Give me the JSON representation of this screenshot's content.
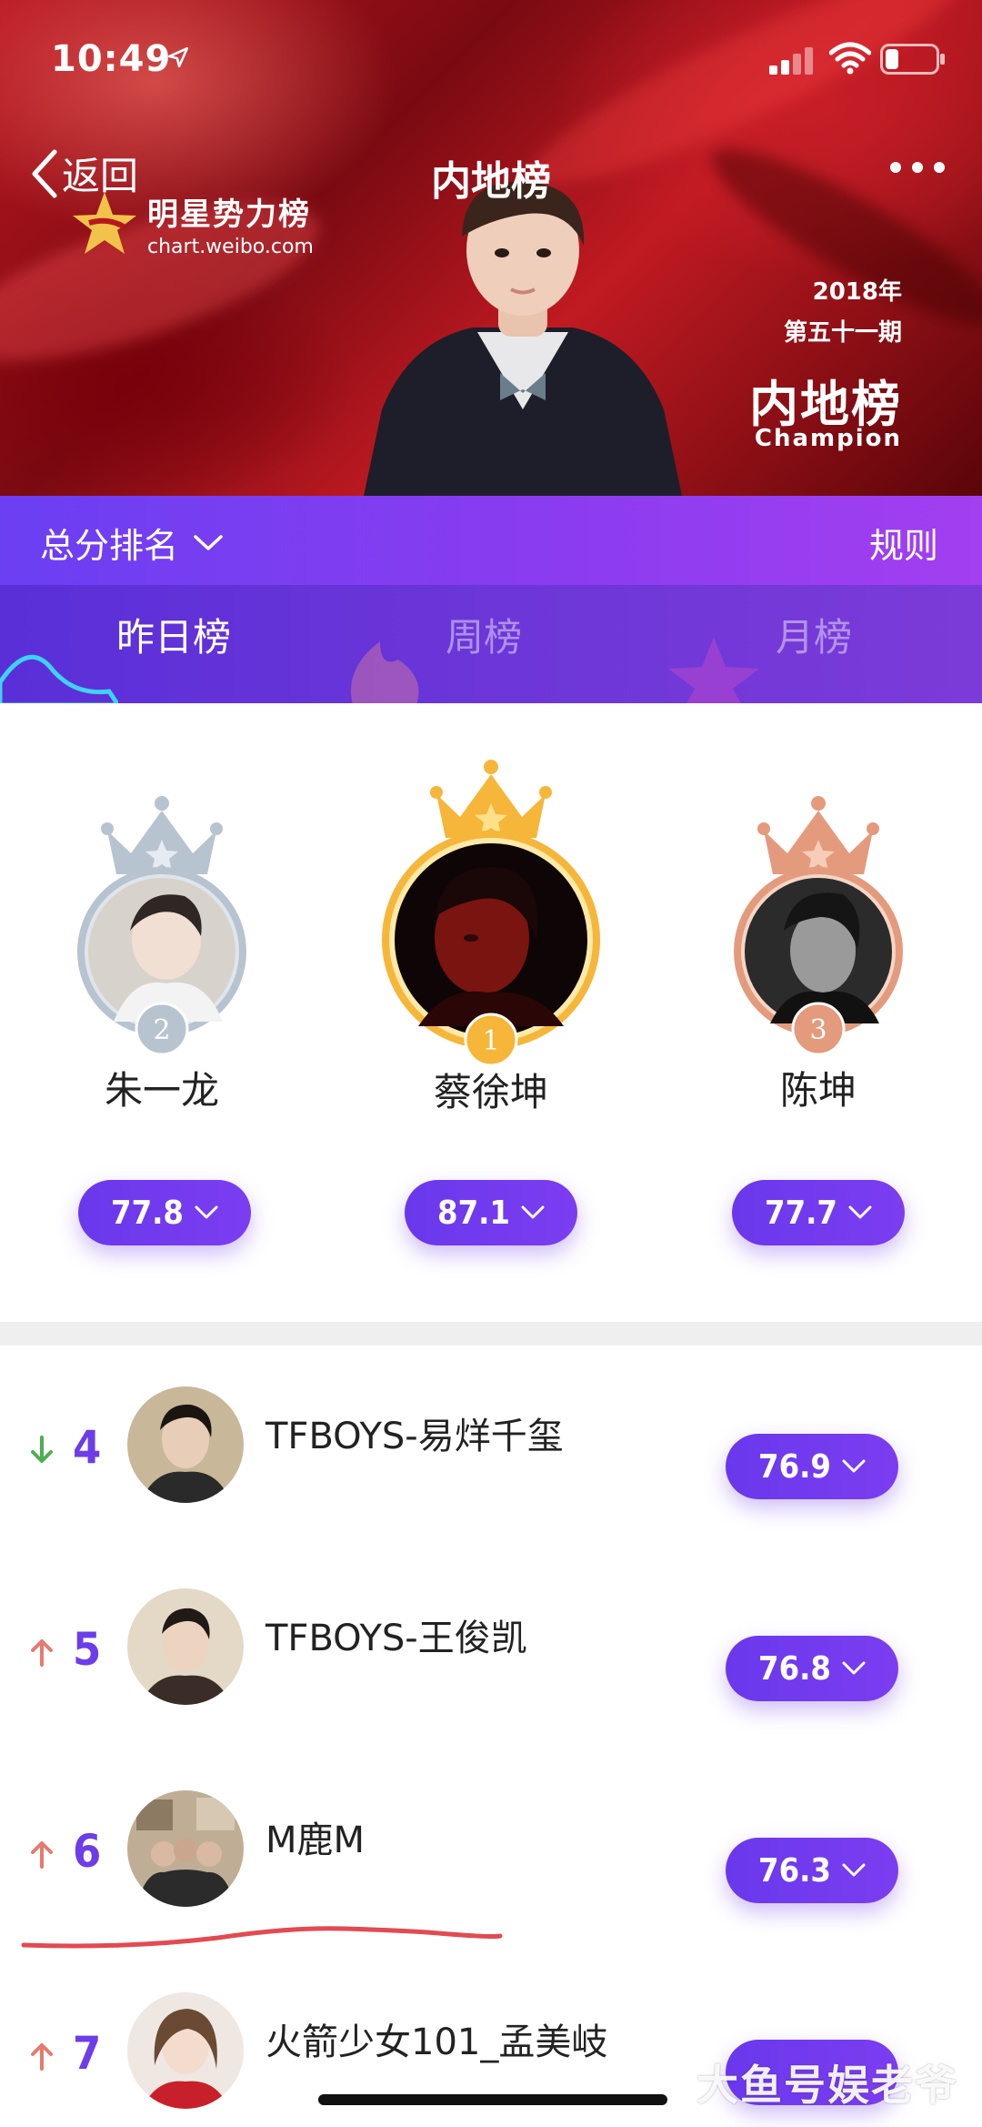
{
  "status_bar": {
    "time": "10:49"
  },
  "nav": {
    "back_label": "返回",
    "title": "内地榜"
  },
  "brand": {
    "name": "明星势力榜",
    "url": "chart.weibo.com"
  },
  "champion": {
    "year": "2018年",
    "issue": "第五十一期",
    "title": "内地榜",
    "label": "Champion"
  },
  "rank_bar": {
    "select_label": "总分排名",
    "rule_label": "规则"
  },
  "tabs": [
    {
      "label": "昨日榜"
    },
    {
      "label": "周榜"
    },
    {
      "label": "月榜"
    }
  ],
  "podium": [
    {
      "rank": "2",
      "name": "朱一龙",
      "score": "77.8",
      "crown": "silver"
    },
    {
      "rank": "1",
      "name": "蔡徐坤",
      "score": "87.1",
      "crown": "gold"
    },
    {
      "rank": "3",
      "name": "陈坤",
      "score": "77.7",
      "crown": "bronze"
    }
  ],
  "list": [
    {
      "rank": "4",
      "name": "TFBOYS-易烊千玺",
      "score": "76.9",
      "trend": "down"
    },
    {
      "rank": "5",
      "name": "TFBOYS-王俊凯",
      "score": "76.8",
      "trend": "up"
    },
    {
      "rank": "6",
      "name": "M鹿M",
      "score": "76.3",
      "trend": "up"
    },
    {
      "rank": "7",
      "name": "火箭少女101_孟美岐",
      "score": "",
      "trend": "up"
    }
  ],
  "watermark": "大鱼号娱老爷",
  "colors": {
    "accent": "#6c3de8",
    "gold": "#f6b63a",
    "silver": "#b8c3d0",
    "bronze": "#e49a7c",
    "trend_up": "#e57a6e",
    "trend_down": "#4caf50"
  }
}
